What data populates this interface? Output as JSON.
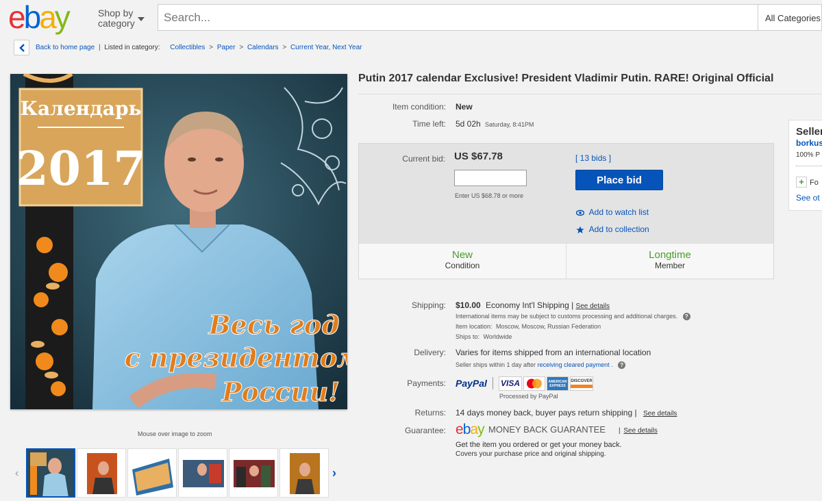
{
  "header": {
    "shop_by": "Shop by",
    "category": "category",
    "search_placeholder": "Search...",
    "all_categories": "All Categories"
  },
  "breadcrumb": {
    "back": "Back to home page",
    "listed_in": "Listed in category:",
    "items": [
      "Collectibles",
      "Paper",
      "Calendars",
      "Current Year, Next Year"
    ]
  },
  "image": {
    "calendar_word": "Календарь",
    "year": "2017",
    "slogan_1": "Весь год",
    "slogan_2": "с президентом",
    "slogan_3": "России!",
    "zoom_hint": "Mouse over image to zoom"
  },
  "listing": {
    "title": "Putin 2017 calendar Exclusive! President Vladimir Putin. RARE! Original Official",
    "item_condition_label": "Item condition:",
    "item_condition_value": "New",
    "time_left_label": "Time left:",
    "time_left_value": "5d 02h",
    "time_left_detail": "Saturday, 8:41PM"
  },
  "bid": {
    "current_bid_label": "Current bid:",
    "current_bid_value": "US $67.78",
    "bids_count": "13 bids",
    "place_bid": "Place bid",
    "enter_hint": "Enter US $68.78 or more",
    "watch": "Add to watch list",
    "collection": "Add to collection",
    "cond_title": "New",
    "cond_sub": "Condition",
    "member_title": "Longtime",
    "member_sub": "Member"
  },
  "shipping": {
    "label": "Shipping:",
    "price": "$10.00",
    "method": "Economy Int'l Shipping",
    "see_details": "See details",
    "note": "International items may be subject to customs processing and additional charges.",
    "location_label": "Item location:",
    "location": "Moscow, Moscow, Russian Federation",
    "ships_to_label": "Ships to:",
    "ships_to": "Worldwide"
  },
  "delivery": {
    "label": "Delivery:",
    "value": "Varies for items shipped from an international location",
    "note_prefix": "Seller ships within 1 day after",
    "note_link": "receiving cleared payment"
  },
  "payments": {
    "label": "Payments:",
    "paypal": "PayPal",
    "processed": "Processed by PayPal",
    "visa": "VISA",
    "amex": "AMERICAN EXPRESS",
    "discover": "DISCOVER"
  },
  "returns": {
    "label": "Returns:",
    "value": "14 days money back, buyer pays return shipping",
    "see_details": "See details"
  },
  "guarantee": {
    "label": "Guarantee:",
    "mbg": "MONEY BACK GUARANTEE",
    "see_details": "See details",
    "line1": "Get the item you ordered or get your money back.",
    "line2": "Covers your purchase price and original shipping."
  },
  "seller": {
    "title": "Seller",
    "name": "borkus",
    "feedback": "100% P",
    "follow": "Fo",
    "see_other": "See ot"
  },
  "colors": {
    "ebay_red": "#e53238",
    "ebay_blue": "#0064d2",
    "ebay_yellow": "#f5af02",
    "ebay_green": "#86b817",
    "link_blue": "#0654ba",
    "condition_green": "#4a9b2a"
  }
}
